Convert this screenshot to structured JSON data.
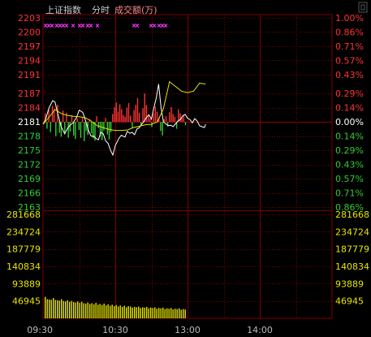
{
  "header": {
    "index_name": "上证指数",
    "mode": "分时",
    "volume_label": "成交额(万)"
  },
  "colors": {
    "background": "#000000",
    "grid": "#7a0000",
    "up": "#ff3333",
    "down": "#33cc33",
    "neutral": "#ffffff",
    "price_line": "#ffffff",
    "avg_line": "#e6e600",
    "volume": "#e6e600",
    "marker": "#ff33ff",
    "time_label": "#bbbbbb"
  },
  "chart_data": [
    {
      "type": "line",
      "name": "price",
      "prev_close": 2181,
      "y_ticks": [
        2203,
        2200,
        2197,
        2194,
        2191,
        2187,
        2184,
        2181,
        2178,
        2175,
        2172,
        2169,
        2166,
        2163
      ],
      "pct_ticks": [
        "1.00%",
        "0.86%",
        "0.71%",
        "0.57%",
        "0.43%",
        "0.29%",
        "0.14%",
        "0.00%",
        "0.14%",
        "0.29%",
        "0.43%",
        "0.57%",
        "0.71%",
        "0.86%"
      ],
      "x_ticks": [
        "09:30",
        "10:30",
        "13:00",
        "14:00"
      ],
      "ylim": [
        2163,
        2203
      ],
      "x_index_range": [
        0,
        240
      ],
      "series": [
        {
          "x": [
            0,
            2,
            5,
            8,
            10,
            12,
            15,
            18,
            20,
            22,
            25,
            28,
            30,
            33,
            35,
            38,
            40,
            42,
            44,
            46,
            48,
            50,
            52,
            54,
            56,
            58,
            60,
            63,
            65,
            68,
            70,
            72,
            74,
            76,
            78,
            80,
            82,
            84,
            86,
            88,
            90,
            92,
            94,
            96,
            98,
            100,
            102,
            104,
            106,
            108,
            110,
            112,
            114,
            116,
            118,
            120,
            122,
            124,
            126,
            128,
            130,
            132,
            134,
            135
          ],
          "values": [
            2180.5,
            2181.5,
            2184.0,
            2185.5,
            2185.2,
            2183.0,
            2180.0,
            2178.5,
            2179.5,
            2180.2,
            2180.8,
            2182.0,
            2183.5,
            2183.0,
            2181.5,
            2179.0,
            2178.0,
            2178.0,
            2177.5,
            2177.2,
            2178.8,
            2178.5,
            2177.0,
            2176.5,
            2175.0,
            2174.0,
            2176.0,
            2177.5,
            2178.2,
            2177.8,
            2179.0,
            2178.6,
            2178.8,
            2178.3,
            2179.5,
            2179.8,
            2180.5,
            2181.2,
            2182.0,
            2182.5,
            2181.6,
            2184.0,
            2186.0,
            2189.0,
            2184.0,
            2181.0,
            2180.6,
            2180.2,
            2180.3,
            2180.0,
            2180.6,
            2181.2,
            2181.5,
            2182.3,
            2182.6,
            2181.8,
            2181.5,
            2180.8,
            2181.7,
            2181.2,
            2180.2,
            2180.0,
            2179.8,
            2180.5
          ]
        },
        {
          "x": [
            0,
            5,
            10,
            15,
            20,
            25,
            30,
            35,
            40,
            45,
            50,
            55,
            60,
            65,
            70,
            75,
            80,
            85,
            90,
            95,
            100,
            105,
            110,
            115,
            120,
            125,
            130,
            135
          ],
          "values": [
            2180.5,
            2182.0,
            2183.6,
            2182.8,
            2182.4,
            2182.2,
            2182.1,
            2181.9,
            2181.2,
            2180.2,
            2179.8,
            2179.4,
            2179.2,
            2179.2,
            2179.3,
            2179.8,
            2180.1,
            2180.4,
            2180.5,
            2181.0,
            2183.8,
            2189.5,
            2188.5,
            2187.5,
            2187.2,
            2187.5,
            2189.2,
            2189.0
          ]
        }
      ]
    },
    {
      "type": "bar",
      "name": "volume",
      "y_ticks": [
        281668,
        234724,
        187779,
        140834,
        93889,
        46945
      ],
      "ylim": [
        0,
        281668
      ],
      "values": [
        58000,
        52000,
        51000,
        50500,
        55000,
        50000,
        49000,
        48000,
        52000,
        47000,
        46000,
        49000,
        45000,
        47000,
        44000,
        43000,
        46000,
        42000,
        45000,
        41000,
        40000,
        43000,
        39000,
        41000,
        38000,
        42000,
        37000,
        39000,
        36000,
        40000,
        35000,
        38000,
        34000,
        37000,
        33000,
        36000,
        32000,
        35000,
        31000,
        34000,
        30000,
        33000,
        32000,
        29000,
        31000,
        30000,
        32000,
        28000,
        30000,
        29000,
        31000,
        27000,
        29000,
        28000,
        30000,
        26000,
        28000,
        27000,
        29000,
        25000,
        27000,
        26000,
        28000,
        24000,
        26000,
        25000,
        27000,
        23000,
        25000,
        24000
      ]
    },
    {
      "type": "bar",
      "name": "breadth",
      "baseline": 0,
      "values": [
        1.5,
        -1.2,
        2.1,
        -1.8,
        2.8,
        2.3,
        -2.5,
        3.0,
        -1.9,
        -2.6,
        2.0,
        -2.2,
        1.6,
        -2.8,
        -1.7,
        1.2,
        -2.4,
        -3.0,
        0.6,
        -1.4,
        -2.8,
        0.8,
        -3.4,
        -1.6,
        -2.3,
        0.5,
        -2.0,
        -2.9,
        -3.3,
        1.0,
        -1.1,
        -2.6,
        -3.2,
        -1.5,
        0.7,
        -2.2,
        -3.1,
        -1.8,
        1.4,
        2.6,
        3.4,
        1.8,
        3.1,
        2.2,
        1.2,
        0.9,
        2.5,
        3.3,
        1.1,
        -1.0,
        2.1,
        3.0,
        4.2,
        1.6,
        -0.7,
        2.4,
        5.0,
        3.0,
        1.3,
        0.6,
        -0.9,
        1.5,
        2.7,
        1.8,
        0.8,
        -1.6,
        -2.4,
        0.5,
        1.0,
        -0.8,
        1.7,
        2.6,
        1.4,
        0.9,
        -1.2,
        2.2,
        1.5,
        0.7,
        1.1,
        -0.6
      ]
    }
  ]
}
